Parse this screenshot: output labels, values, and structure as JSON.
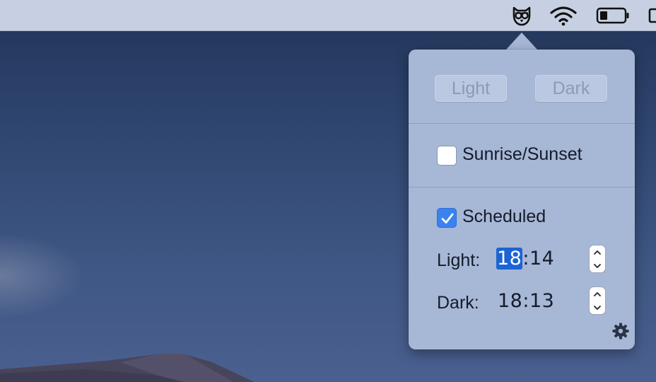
{
  "menubar": {
    "icons": [
      "owl-icon",
      "wifi-icon",
      "battery-icon",
      "display-icon"
    ]
  },
  "popover": {
    "light_button": "Light",
    "dark_button": "Dark",
    "sunrise_sunset": {
      "label": "Sunrise/Sunset",
      "checked": false
    },
    "scheduled": {
      "label": "Scheduled",
      "checked": true
    },
    "light_time": {
      "label": "Light:",
      "hour": "18",
      "rest": ":14"
    },
    "dark_time": {
      "label": "Dark:",
      "value": "18:13"
    },
    "settings_icon": "gear-icon"
  },
  "colors": {
    "accent": "#3b82f0",
    "selection": "#1d63d3",
    "popover_bg": "#a7b7d6",
    "menubar_bg": "#c7d0e2"
  }
}
